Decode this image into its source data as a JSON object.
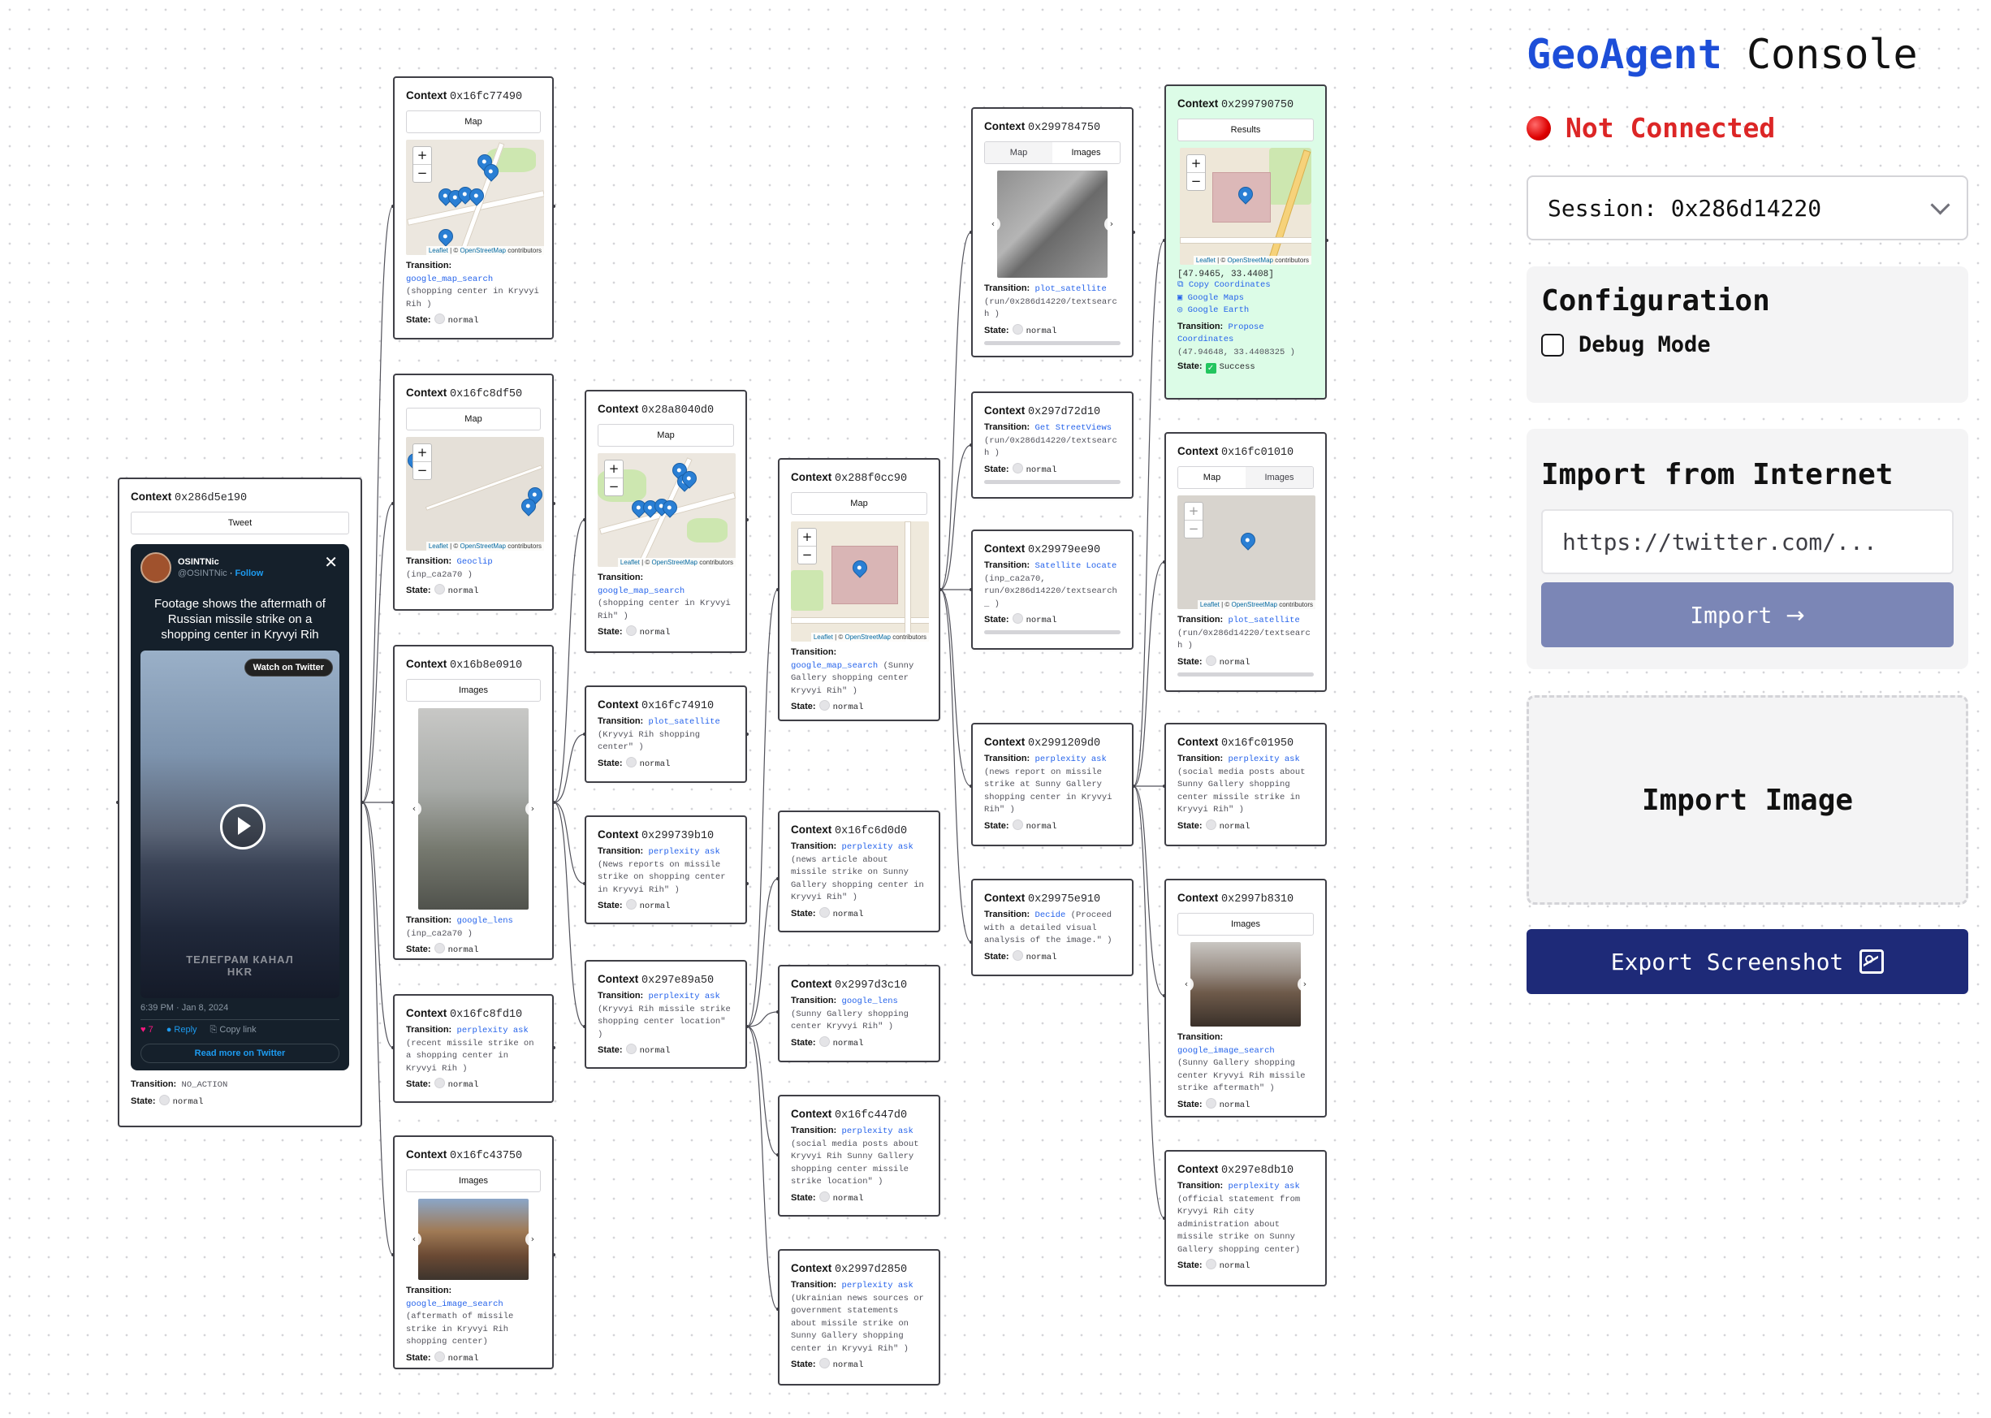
{
  "console": {
    "brand": "GeoAgent",
    "title": "Console",
    "status": "Not Connected",
    "session": "Session: 0x286d14220",
    "config_title": "Configuration",
    "debug_label": "Debug Mode",
    "import_title": "Import from Internet",
    "url_placeholder": "https://twitter.com/...",
    "import_button": "Import",
    "import_image": "Import Image",
    "export_button": "Export Screenshot"
  },
  "common": {
    "context": "Context",
    "transition": "Transition:",
    "state": "State:",
    "leaflet": "Leaflet",
    "osm": "OpenStreetMap",
    "contributors": "contributors",
    "zoom_in": "+",
    "zoom_out": "−",
    "prev": "‹",
    "next": "›"
  },
  "tweet": {
    "tab": "Tweet",
    "author": "OSINTNic",
    "handle": "@OSINTNic",
    "follow": "Follow",
    "text": "Footage shows the aftermath of Russian missile strike on a shopping center in Kryvyi Rih",
    "watch": "Watch on Twitter",
    "watermark": "ТЕЛЕГРАМ КАНАЛ\nHKR",
    "date": "6:39 PM · Jan 8, 2024",
    "likes": "7",
    "reply": "Reply",
    "copy": "Copy link",
    "read_more": "Read more on Twitter"
  },
  "nodes": {
    "n0": {
      "id": "0x286d5e190",
      "tab1": "Tweet",
      "fn": "NO_ACTION",
      "args": "",
      "state": "normal"
    },
    "n1": {
      "id": "0x16fc77490",
      "tab1": "Map",
      "fn": "google_map_search",
      "args": "(shopping center in Kryvyi Rih )",
      "state": "normal"
    },
    "n2": {
      "id": "0x16fc8df50",
      "tab1": "Map",
      "fn": "Geoclip",
      "args": "(inp_ca2a70 )",
      "state": "normal"
    },
    "n3": {
      "id": "0x16b8e0910",
      "tab1": "Images",
      "fn": "google_lens",
      "args": "(inp_ca2a70 )",
      "state": "normal"
    },
    "n4": {
      "id": "0x16fc8fd10",
      "fn": "perplexity ask",
      "args": "(recent missile strike on a shopping center in Kryvyi Rih )",
      "state": "normal"
    },
    "n5": {
      "id": "0x16fc43750",
      "tab1": "Images",
      "fn": "google_image_search",
      "args": "(aftermath of missile strike in Kryvyi Rih shopping center)",
      "state": "normal"
    },
    "n6": {
      "id": "0x28a8040d0",
      "tab1": "Map",
      "fn": "google_map_search",
      "args": "(shopping center in Kryvyi Rih\" )",
      "state": "normal"
    },
    "n7": {
      "id": "0x16fc74910",
      "fn": "plot_satellite",
      "args": "(Kryvyi Rih shopping center\" )",
      "state": "normal"
    },
    "n8": {
      "id": "0x299739b10",
      "fn": "perplexity ask",
      "args": "(News reports on missile strike on shopping center in Kryvyi Rih\" )",
      "state": "normal"
    },
    "n9": {
      "id": "0x297e89a50",
      "fn": "perplexity ask",
      "args": "(Kryvyi Rih missile strike shopping center location\" )",
      "state": "normal"
    },
    "n10": {
      "id": "0x288f0cc90",
      "tab1": "Map",
      "fn": "google_map_search",
      "args": "(Sunny Gallery shopping center Kryvyi Rih\" )",
      "state": "normal"
    },
    "n11": {
      "id": "0x16fc6d0d0",
      "fn": "perplexity ask",
      "args": "(news article about missile strike on Sunny Gallery shopping center in Kryvyi Rih\" )",
      "state": "normal"
    },
    "n12": {
      "id": "0x2997d3c10",
      "fn": "google_lens",
      "args": "(Sunny Gallery shopping center Kryvyi Rih\" )",
      "state": "normal"
    },
    "n13": {
      "id": "0x16fc447d0",
      "fn": "perplexity ask",
      "args": "(social media posts about Kryvyi Rih Sunny Gallery shopping center missile strike location\" )",
      "state": "normal"
    },
    "n14": {
      "id": "0x2997d2850",
      "fn": "perplexity ask",
      "args": "(Ukrainian news sources or government statements about missile strike on Sunny Gallery shopping center in Kryvyi Rih\" )",
      "state": "normal"
    },
    "n15": {
      "id": "0x299784750",
      "tab1": "Map",
      "tab2": "Images",
      "fn": "plot_satellite",
      "args": "(run/0x286d14220/textsearch )",
      "state": "normal"
    },
    "n16": {
      "id": "0x297d72d10",
      "fn": "Get StreetViews",
      "args": "(run/0x286d14220/textsearch )",
      "state": "normal"
    },
    "n17": {
      "id": "0x29979ee90",
      "fn": "Satellite Locate",
      "args": "(inp_ca2a70, run/0x286d14220/textsearch_ )",
      "state": "normal"
    },
    "n18": {
      "id": "0x2991209d0",
      "fn": "perplexity ask",
      "args": "(news report on missile strike at Sunny Gallery shopping center in Kryvyi Rih\" )",
      "state": "normal"
    },
    "n19": {
      "id": "0x29975e910",
      "fn": "Decide",
      "args": "(Proceed with a detailed visual analysis of the image.\" )",
      "state": "normal"
    },
    "n20": {
      "id": "0x299790750",
      "tab1": "Results",
      "coords": "[47.9465, 33.4408]",
      "copy": "Copy Coordinates",
      "gmaps": "Google Maps",
      "gearth": "Google Earth",
      "fn": "Propose Coordinates",
      "args": "(47.94648, 33.4408325 )",
      "state": "Success"
    },
    "n21": {
      "id": "0x16fc01010",
      "tab1": "Map",
      "tab2": "Images",
      "fn": "plot_satellite",
      "args": "(run/0x286d14220/textsearch )",
      "state": "normal"
    },
    "n22": {
      "id": "0x16fc01950",
      "fn": "perplexity ask",
      "args": "(social media posts about Sunny Gallery shopping center missile strike in Kryvyi Rih\" )",
      "state": "normal"
    },
    "n23": {
      "id": "0x2997b8310",
      "tab1": "Images",
      "fn": "google_image_search",
      "args": "(Sunny Gallery shopping center Kryvyi Rih missile strike aftermath\" )",
      "state": "normal"
    },
    "n24": {
      "id": "0x297e8db10",
      "fn": "perplexity ask",
      "args": "(official statement from Kryvyi Rih city administration about missile strike on Sunny Gallery shopping center)",
      "state": "normal"
    }
  }
}
